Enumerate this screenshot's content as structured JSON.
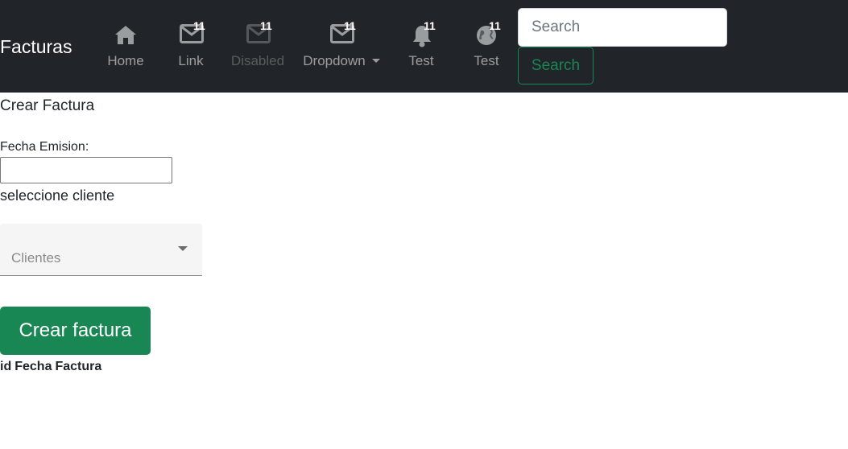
{
  "navbar": {
    "brand": "Facturas",
    "items": [
      {
        "label": "Home",
        "icon": "home-icon",
        "badge": ""
      },
      {
        "label": "Link",
        "icon": "envelope-icon",
        "badge": "11"
      },
      {
        "label": "Disabled",
        "icon": "envelope-icon",
        "badge": "11"
      },
      {
        "label": "Dropdown",
        "icon": "envelope-icon",
        "badge": "11"
      },
      {
        "label": "Test",
        "icon": "bell-icon",
        "badge": "11"
      },
      {
        "label": "Test",
        "icon": "globe-icon",
        "badge": "11"
      }
    ],
    "search": {
      "placeholder": "Search",
      "button_label": "Search"
    }
  },
  "form": {
    "title": "Crear Factura",
    "fecha_label": "Fecha Emision:",
    "fecha_value": "",
    "cliente_label": "seleccione cliente",
    "clientes_placeholder": "Clientes",
    "submit_label": "Crear factura"
  },
  "table": {
    "headers": [
      "id",
      "Fecha",
      "Factura"
    ]
  },
  "colors": {
    "navbar_bg": "#212529",
    "success": "#198754"
  }
}
